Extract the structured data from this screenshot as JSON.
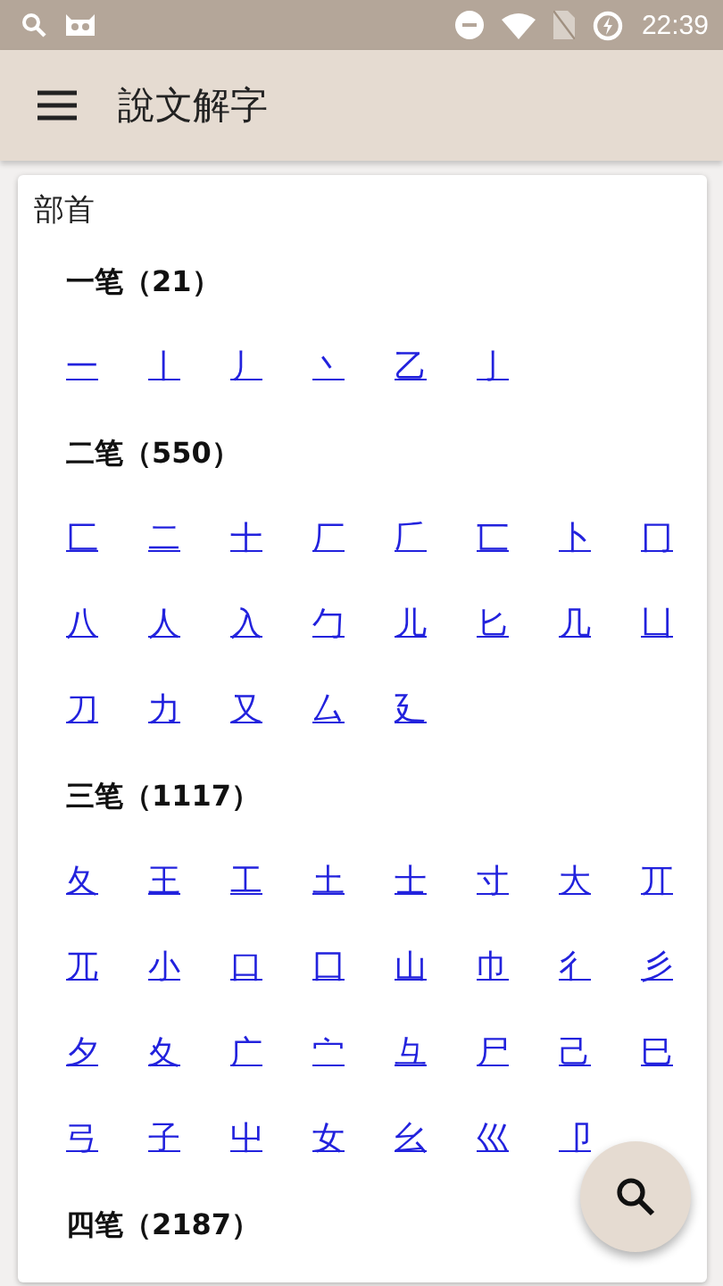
{
  "status_bar": {
    "time": "22:39"
  },
  "toolbar": {
    "title": "說文解字"
  },
  "card": {
    "heading": "部首",
    "sections": [
      {
        "title": "一笔（21）",
        "radicals": [
          "一",
          "丨",
          "丿",
          "丶",
          "乙",
          "亅"
        ]
      },
      {
        "title": "二笔（550）",
        "radicals": [
          "匚",
          "二",
          "十",
          "厂",
          "𠂆",
          "匸",
          "卜",
          "冂",
          "八",
          "人",
          "入",
          "勹",
          "儿",
          "匕",
          "几",
          "凵",
          "刀",
          "力",
          "又",
          "厶",
          "廴"
        ]
      },
      {
        "title": "三笔（1117）",
        "radicals": [
          "夂",
          "王",
          "工",
          "土",
          "士",
          "寸",
          "大",
          "丌",
          "兀",
          "小",
          "口",
          "囗",
          "山",
          "巾",
          "彳",
          "彡",
          "夕",
          "夊",
          "广",
          "宀",
          "彑",
          "尸",
          "己",
          "巳",
          "弓",
          "子",
          "屮",
          "女",
          "幺",
          "巛",
          "卩"
        ]
      },
      {
        "title": "四笔（2187）"
      }
    ]
  }
}
